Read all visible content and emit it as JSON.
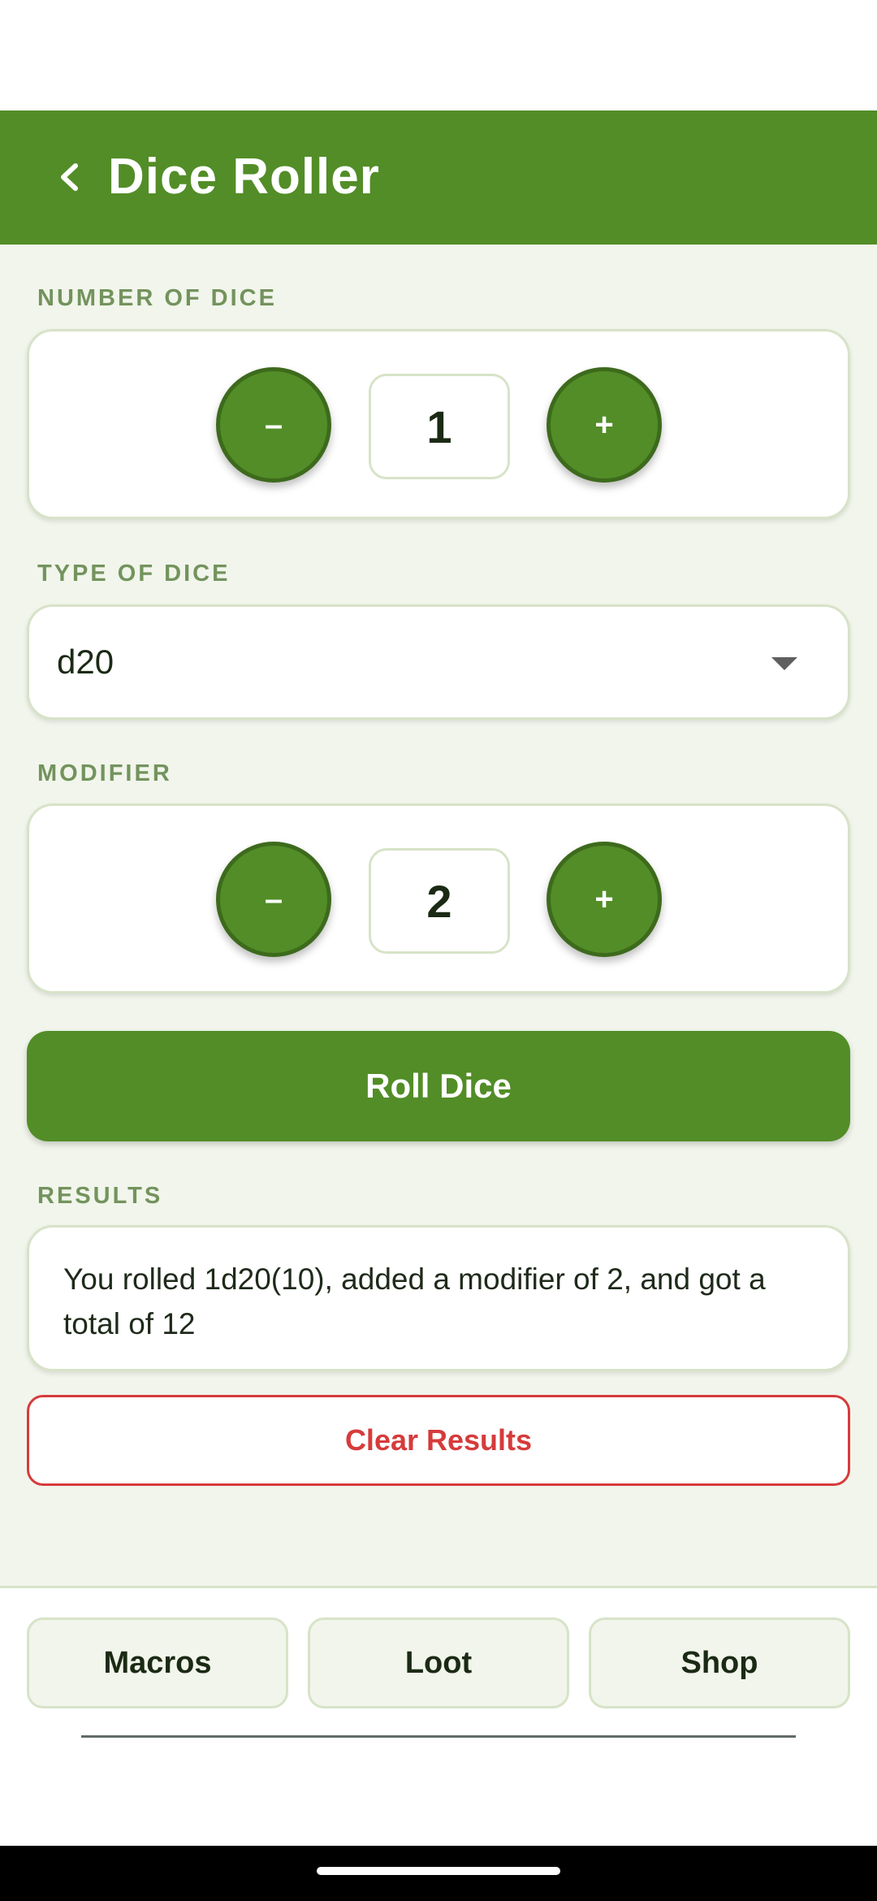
{
  "app_bar": {
    "back_icon": "chevron-left-icon",
    "title": "Dice Roller",
    "color": "#528d27"
  },
  "number_of_dice": {
    "label": "NUMBER OF DICE",
    "minus_label": "–",
    "plus_label": "+",
    "value": "1"
  },
  "type_of_dice": {
    "label": "TYPE OF DICE",
    "selected": "d20",
    "arrow_icon": "dropdown-arrow-icon"
  },
  "modifier": {
    "label": "MODIFIER",
    "minus_label": "–",
    "plus_label": "+",
    "value": "2"
  },
  "roll_button": {
    "label": "Roll Dice"
  },
  "results": {
    "label": "RESULTS",
    "text": "You rolled 1d20(10), added a modifier of 2, and got a total of 12"
  },
  "clear_button": {
    "label": "Clear Results",
    "color": "#d63b3b"
  },
  "bottom_nav": {
    "items": [
      {
        "label": "Macros"
      },
      {
        "label": "Loot"
      },
      {
        "label": "Shop"
      }
    ]
  }
}
